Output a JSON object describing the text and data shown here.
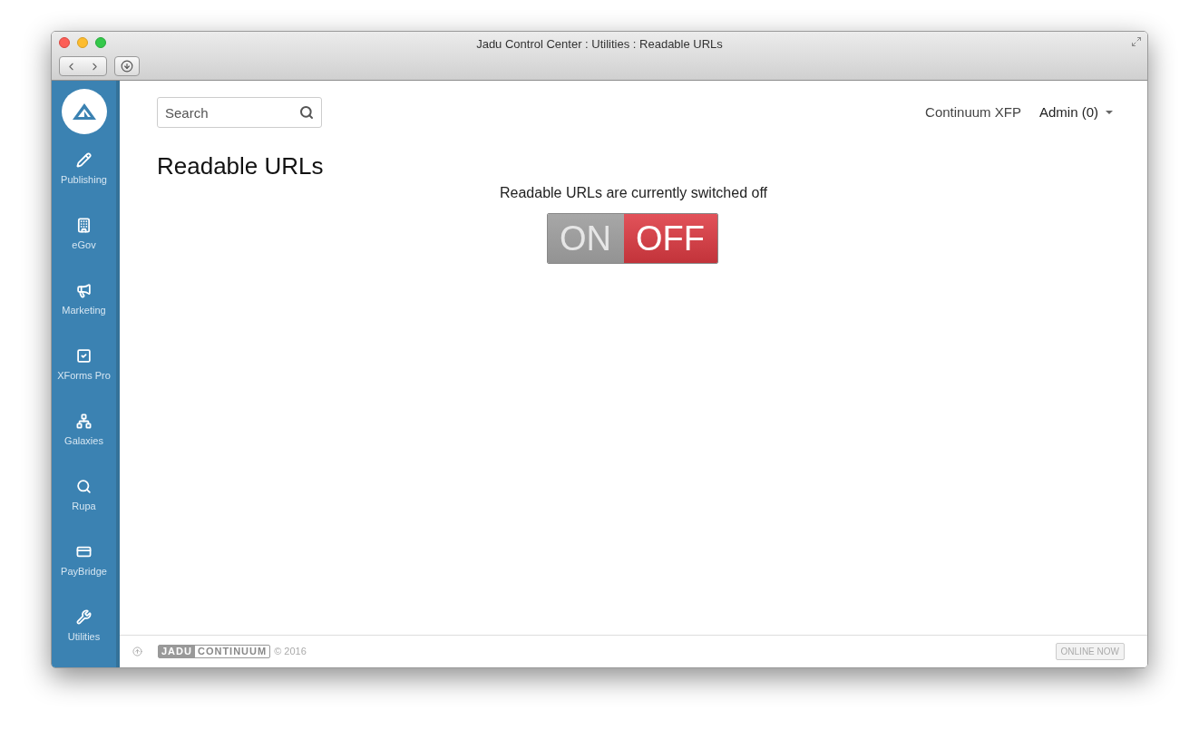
{
  "window": {
    "title": "Jadu Control Center : Utilities : Readable URLs"
  },
  "sidebar": {
    "items": [
      {
        "label": "Publishing",
        "kind": "pencil"
      },
      {
        "label": "eGov",
        "kind": "building"
      },
      {
        "label": "Marketing",
        "kind": "megaphone"
      },
      {
        "label": "XForms Pro",
        "kind": "check"
      },
      {
        "label": "Galaxies",
        "kind": "network"
      },
      {
        "label": "Rupa",
        "kind": "search"
      },
      {
        "label": "PayBridge",
        "kind": "card"
      },
      {
        "label": "Utilities",
        "kind": "wrench"
      }
    ]
  },
  "search": {
    "placeholder": "Search"
  },
  "header": {
    "site": "Continuum XFP",
    "user": "Admin (0)"
  },
  "page": {
    "title": "Readable URLs",
    "message": "Readable URLs are currently switched off",
    "toggle": {
      "on": false,
      "on_label": "ON",
      "off_label": "OFF"
    }
  },
  "footer": {
    "logo_left": "JADU",
    "logo_right": "CONTINUUM",
    "copyright": "© 2016",
    "status": "ONLINE NOW"
  }
}
